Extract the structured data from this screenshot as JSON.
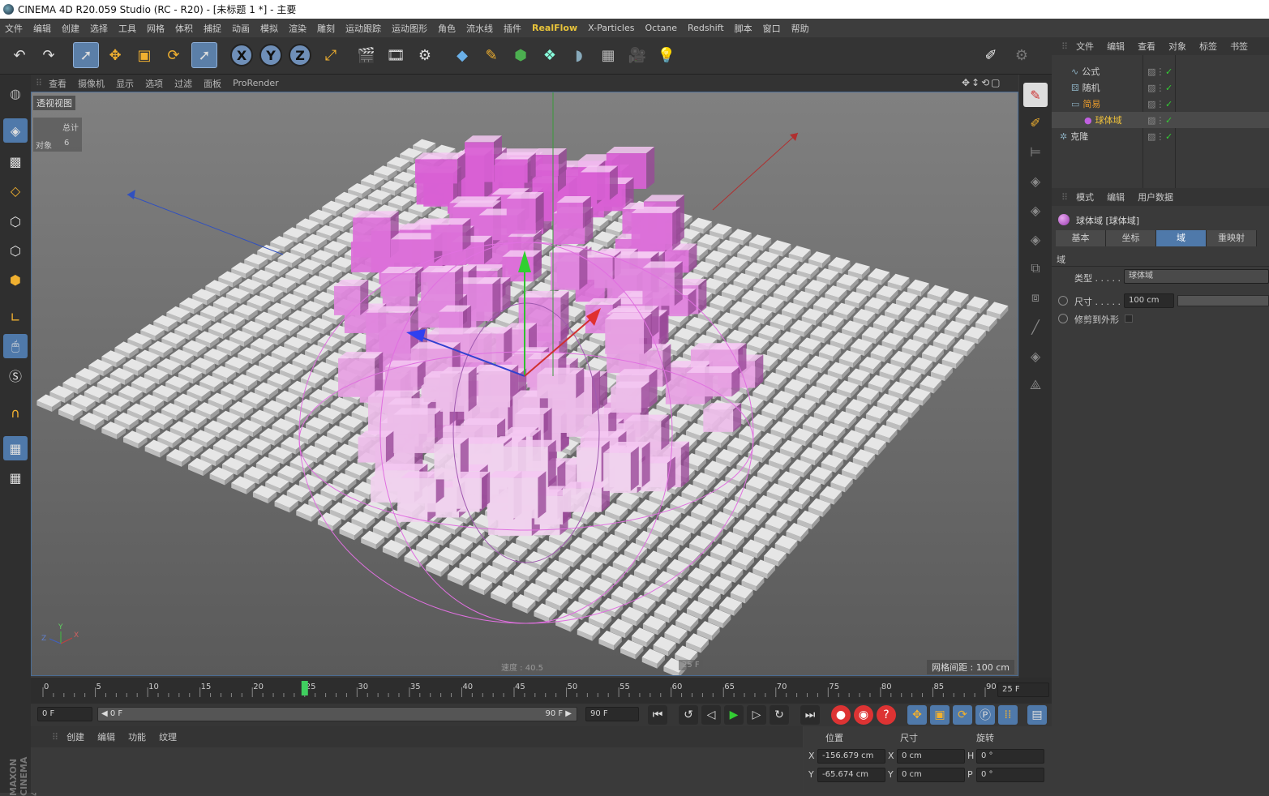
{
  "window": {
    "title": "CINEMA 4D R20.059 Studio (RC - R20) - [未标题 1 *] - 主要"
  },
  "menu": [
    "文件",
    "编辑",
    "创建",
    "选择",
    "工具",
    "网格",
    "体积",
    "捕捉",
    "动画",
    "模拟",
    "渲染",
    "雕刻",
    "运动跟踪",
    "运动图形",
    "角色",
    "流水线",
    "插件",
    "RealFlow",
    "X-Particles",
    "Octane",
    "Redshift",
    "脚本",
    "窗口",
    "帮助"
  ],
  "viewport": {
    "menu": [
      "查看",
      "摄像机",
      "显示",
      "选项",
      "过滤",
      "面板",
      "ProRender"
    ],
    "name": "透视视图",
    "stats_total_label": "总计",
    "stats_object_label": "对象",
    "stats_object_count": "6",
    "grid_spacing": "网格间距 : 100 cm",
    "speed_text": "速度 : 40.5",
    "frame_overlay": "25 F"
  },
  "object_manager": {
    "menu": [
      "文件",
      "编辑",
      "查看",
      "对象",
      "标签",
      "书签"
    ],
    "objects": [
      {
        "name": "公式",
        "color": "#cfcfcf"
      },
      {
        "name": "随机",
        "color": "#cfcfcf"
      },
      {
        "name": "简易",
        "color": "#e89a2c"
      },
      {
        "name": "球体域",
        "color": "#f0c23a"
      },
      {
        "name": "克隆",
        "color": "#cfcfcf"
      }
    ]
  },
  "attributes": {
    "menu": [
      "模式",
      "编辑",
      "用户数据"
    ],
    "object_title": "球体域 [球体域]",
    "tabs": [
      "基本",
      "坐标",
      "域",
      "重映射"
    ],
    "active_tab": "域",
    "section": "域",
    "type_label": "类型",
    "type_value": "球体域",
    "size_label": "尺寸",
    "size_value": "100 cm",
    "clip_label": "修剪到外形"
  },
  "timeline": {
    "ticks": [
      "0",
      "5",
      "10",
      "15",
      "20",
      "25",
      "30",
      "35",
      "40",
      "45",
      "50",
      "55",
      "60",
      "65",
      "70",
      "75",
      "80",
      "85",
      "90"
    ],
    "current_frame": "25",
    "frame_field": "25 F"
  },
  "transport": {
    "start_field": "0 F",
    "range_start": "0 F",
    "range_end": "90 F",
    "end_field": "90 F"
  },
  "material_manager": {
    "menu": [
      "创建",
      "编辑",
      "功能",
      "纹理"
    ]
  },
  "coordinates": {
    "headers": [
      "位置",
      "尺寸",
      "旋转"
    ],
    "rows": [
      {
        "axis": "X",
        "pos": "-156.679 cm",
        "size_axis": "X",
        "size": "0 cm",
        "rot_axis": "H",
        "rot": "0 °"
      },
      {
        "axis": "Y",
        "pos": "-65.674 cm",
        "size_axis": "Y",
        "size": "0 cm",
        "rot_axis": "P",
        "rot": "0 °"
      }
    ]
  },
  "side_logo": "MAXON CINEMA 4D",
  "colors": {
    "accent": "#4f79aa",
    "pink": "#d66fd2",
    "grid_cube": "#e6e6e6"
  }
}
